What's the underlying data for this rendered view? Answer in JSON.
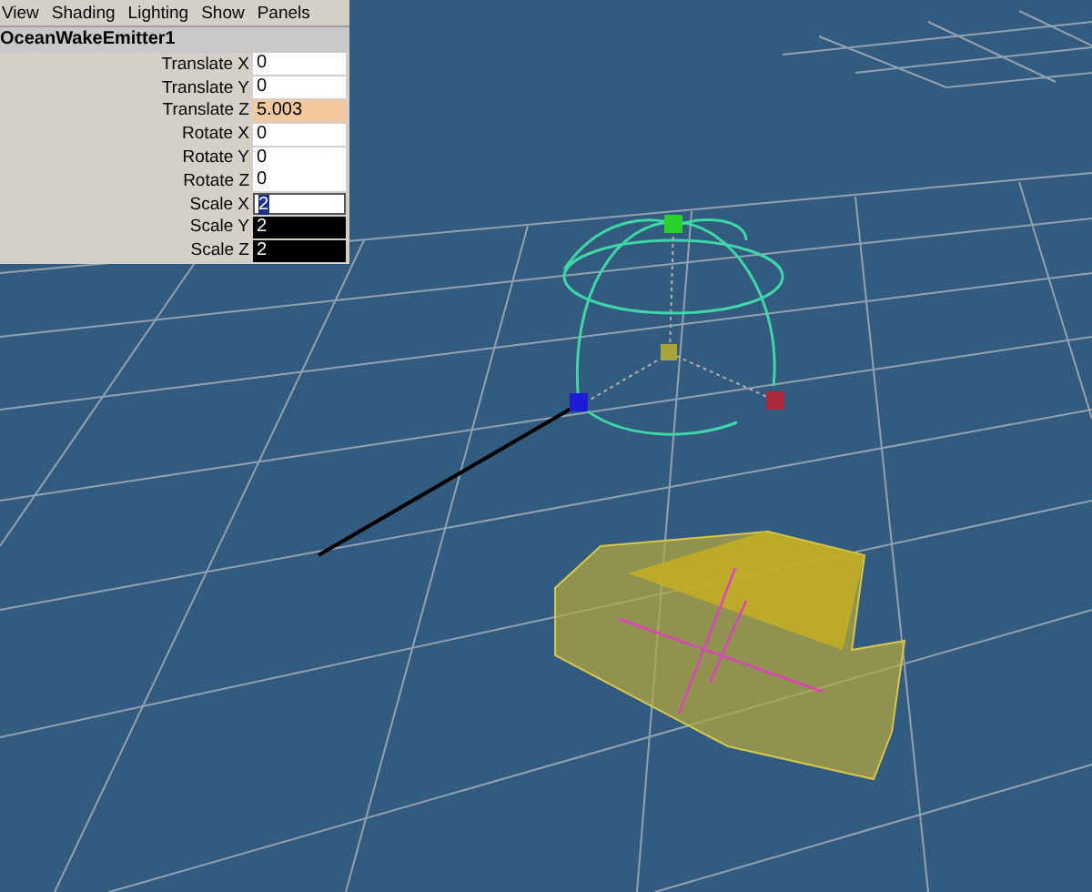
{
  "menu": [
    {
      "label": "View"
    },
    {
      "label": "Shading"
    },
    {
      "label": "Lighting"
    },
    {
      "label": "Show"
    },
    {
      "label": "Panels"
    }
  ],
  "channel_box": {
    "title": "OceanWakeEmitter1",
    "channels": [
      {
        "label": "Translate X",
        "value": "0",
        "keyed": false,
        "selected": false,
        "editing": false
      },
      {
        "label": "Translate Y",
        "value": "0",
        "keyed": false,
        "selected": false,
        "editing": false
      },
      {
        "label": "Translate Z",
        "value": "5.003",
        "keyed": true,
        "selected": false,
        "editing": false
      },
      {
        "label": "Rotate X",
        "value": "0",
        "keyed": false,
        "selected": false,
        "editing": false
      },
      {
        "label": "Rotate Y",
        "value": "0",
        "keyed": false,
        "selected": false,
        "editing": false
      },
      {
        "label": "Rotate Z",
        "value": "0",
        "keyed": false,
        "selected": false,
        "editing": false
      },
      {
        "label": "Scale X",
        "value": "2",
        "keyed": false,
        "selected": true,
        "editing": true
      },
      {
        "label": "Scale Y",
        "value": "2",
        "keyed": false,
        "selected": true,
        "editing": false
      },
      {
        "label": "Scale Z",
        "value": "2",
        "keyed": false,
        "selected": true,
        "editing": false
      }
    ]
  }
}
